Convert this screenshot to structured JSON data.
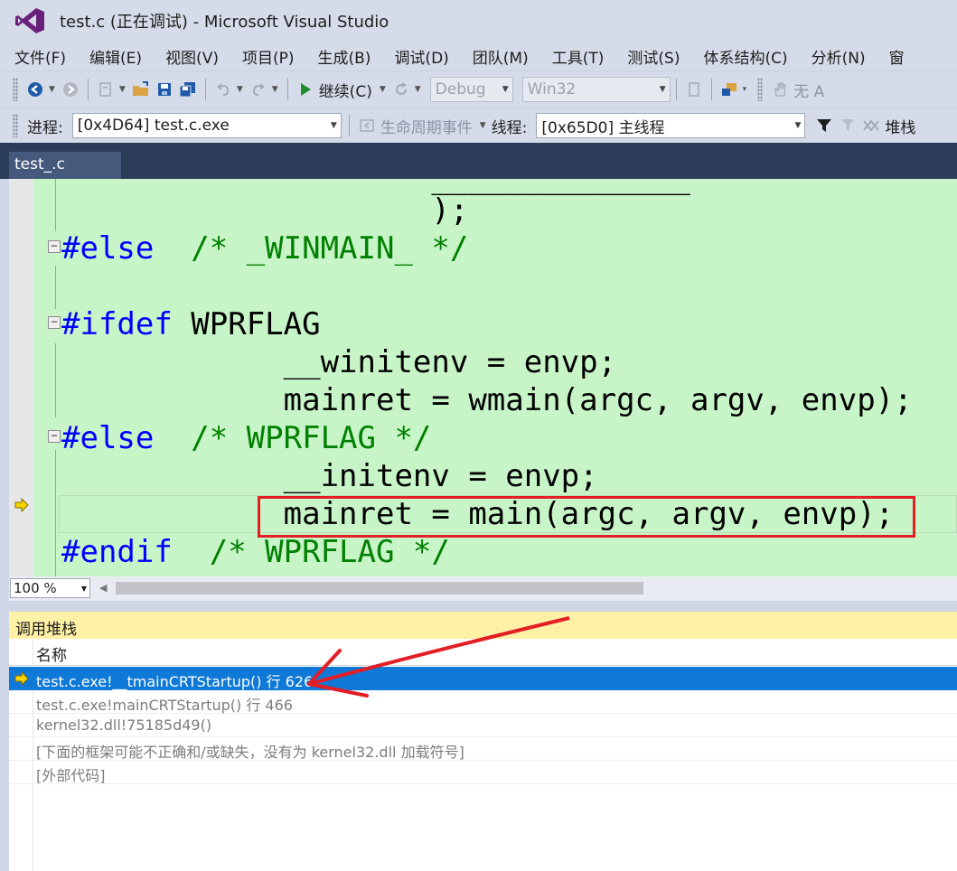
{
  "window": {
    "title": "test.c (正在调试) - Microsoft Visual Studio"
  },
  "menu": {
    "items": [
      "文件(F)",
      "编辑(E)",
      "视图(V)",
      "项目(P)",
      "生成(B)",
      "调试(D)",
      "团队(M)",
      "工具(T)",
      "测试(S)",
      "体系结构(C)",
      "分析(N)",
      "窗"
    ]
  },
  "toolbar1": {
    "continue_label": "继续(C)",
    "config_value": "Debug",
    "platform_value": "Win32",
    "trailing_label": "无 A"
  },
  "toolbar2": {
    "process_label": "进程:",
    "process_value": "[0x4D64] test.c.exe",
    "lifecycle_label": "生命周期事件",
    "thread_label": "线程:",
    "thread_value": "[0x65D0] 主线程",
    "stack_label": "堆栈"
  },
  "tabs": {
    "active": "test_.c"
  },
  "editor": {
    "lines": [
      {
        "text_plain": "                    );"
      },
      {
        "kw": "#else",
        "comment": "  /* _WINMAIN_ */"
      },
      {
        "kw": "#ifdef",
        "plain": " WPRFLAG"
      },
      {
        "plain": "            __winitenv = envp;"
      },
      {
        "plain": "            mainret = wmain(argc, argv, envp);"
      },
      {
        "kw": "#else",
        "comment": "  /* WPRFLAG */"
      },
      {
        "plain": "            __initenv = envp;"
      },
      {
        "plain": "            mainret = main(argc, argv, envp);"
      },
      {
        "kw": "#endif",
        "comment": "  /* WPRFLAG */"
      }
    ],
    "zoom": "100 %"
  },
  "callstack": {
    "title": "调用堆栈",
    "column_name": "名称",
    "rows": [
      "test.c.exe!__tmainCRTStartup() 行 626",
      "test.c.exe!mainCRTStartup() 行 466",
      "kernel32.dll!75185d49()",
      "[下面的框架可能不正确和/或缺失，没有为 kernel32.dll 加载符号]",
      "[外部代码]"
    ]
  },
  "colors": {
    "editor_bg": "#c8f5c8",
    "keyword": "#0000ff",
    "comment": "#008000",
    "selection": "#0f79d8",
    "annotation": "#e31e24",
    "panel_title_bg": "#fff1a6"
  }
}
